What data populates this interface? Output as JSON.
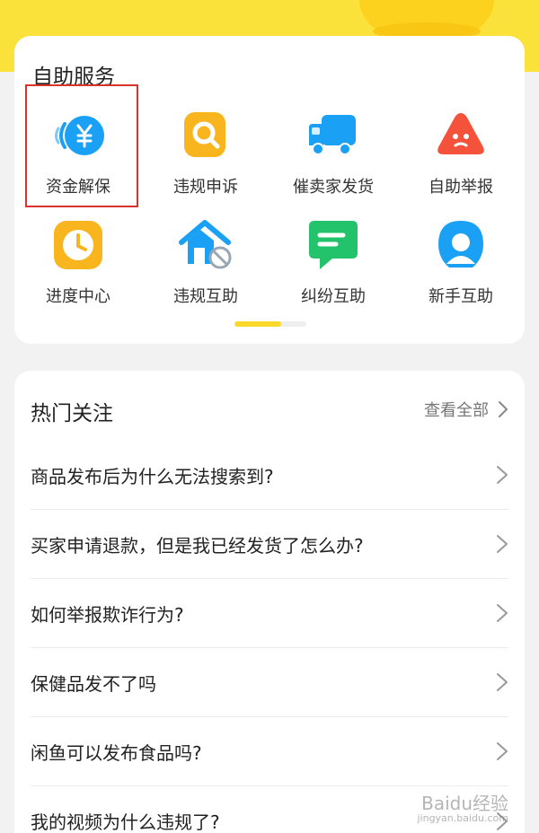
{
  "services": {
    "title": "自助服务",
    "items": [
      {
        "label": "资金解保",
        "icon": "yuan-coin-icon",
        "color": "#1aa0f5"
      },
      {
        "label": "违规申诉",
        "icon": "search-icon",
        "color": "#f8b51d"
      },
      {
        "label": "催卖家发货",
        "icon": "truck-icon",
        "color": "#1aa0f5"
      },
      {
        "label": "自助举报",
        "icon": "report-icon",
        "color": "#f4523a"
      },
      {
        "label": "进度中心",
        "icon": "clock-icon",
        "color": "#f8b51d"
      },
      {
        "label": "违规互助",
        "icon": "house-block-icon",
        "color": "#1aa0f5"
      },
      {
        "label": "纠纷互助",
        "icon": "message-icon",
        "color": "#22c36a"
      },
      {
        "label": "新手互助",
        "icon": "user-icon",
        "color": "#1aa0f5"
      }
    ]
  },
  "hot": {
    "title": "热门关注",
    "see_all": "查看全部",
    "items": [
      "商品发布后为什么无法搜索到?",
      "买家申请退款，但是我已经发货了怎么办?",
      "如何举报欺诈行为?",
      "保健品发不了吗",
      "闲鱼可以发布食品吗?",
      "我的视频为什么违规了?"
    ]
  },
  "watermark": {
    "text": "Baidu经验",
    "sub": "jingyan.baidu.com"
  }
}
